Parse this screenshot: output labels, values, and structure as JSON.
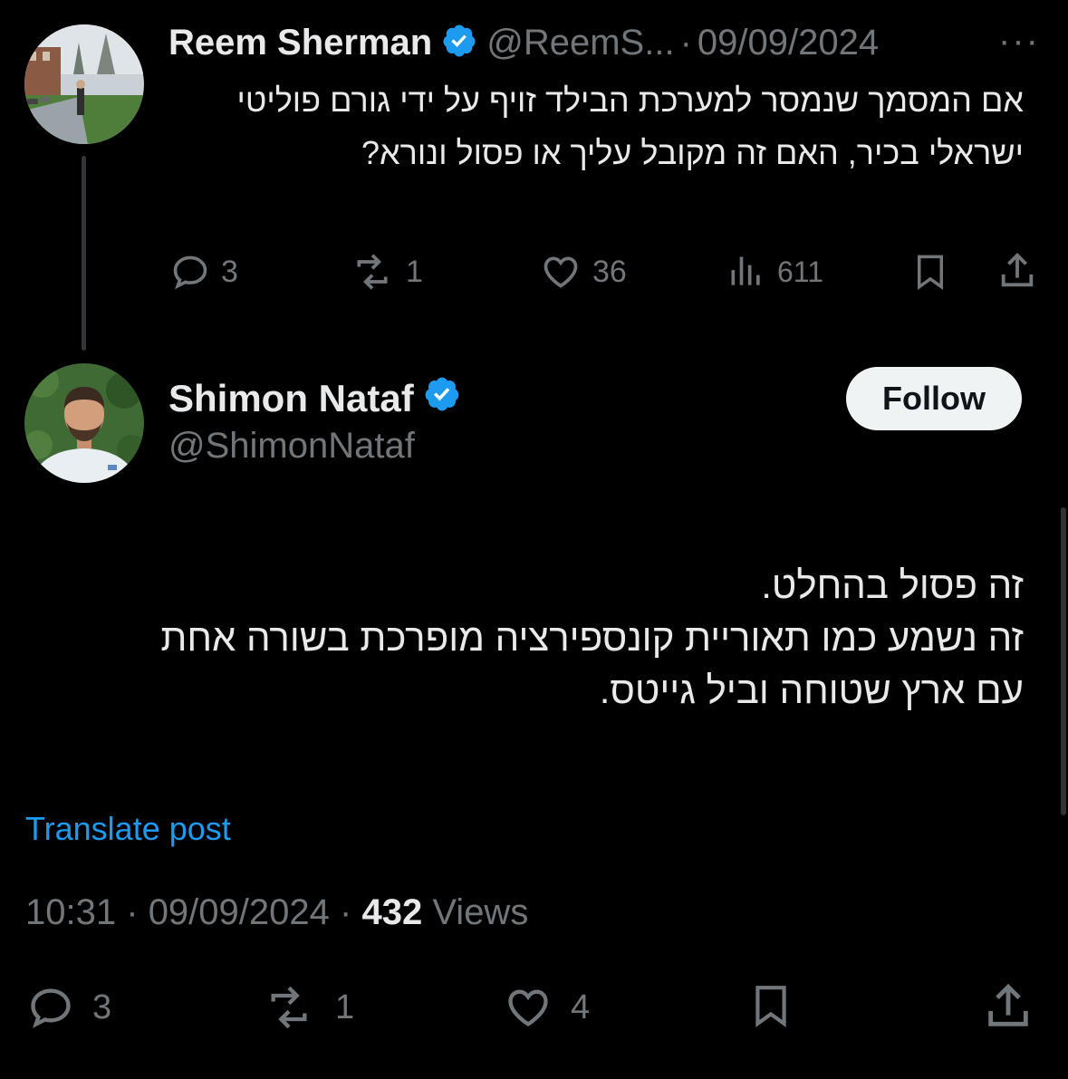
{
  "parent_tweet": {
    "display_name": "Reem Sherman",
    "handle": "@ReemS...",
    "separator": "·",
    "date": "09/09/2024",
    "more": "···",
    "text": "אם המסמך שנמסר למערכת הבילד זויף על ידי גורם פוליטי ישראלי בכיר, האם זה מקובל עליך או פסול ונורא?",
    "actions": {
      "replies": "3",
      "reposts": "1",
      "likes": "36",
      "views": "611"
    }
  },
  "main_tweet": {
    "display_name": "Shimon Nataf",
    "handle": "@ShimonNataf",
    "follow_label": "Follow",
    "text_lines": [
      "זה פסול בהחלט.",
      "זה נשמע כמו תאוריית קונספירציה מופרכת בשורה אחת",
      "עם ארץ שטוחה וביל גייטס."
    ],
    "translate_label": "Translate post",
    "time": "10:31",
    "date": "09/09/2024",
    "separator": "·",
    "views_count": "432",
    "views_label": "Views",
    "actions": {
      "replies": "3",
      "reposts": "1",
      "likes": "4"
    }
  },
  "colors": {
    "background": "#000000",
    "text": "#e7e9ea",
    "secondary": "#71767b",
    "accent": "#1d9bf0",
    "verified": "#1d9bf0"
  },
  "icons": [
    "reply-icon",
    "repost-icon",
    "like-icon",
    "views-icon",
    "bookmark-icon",
    "share-icon",
    "verified-badge-icon"
  ]
}
